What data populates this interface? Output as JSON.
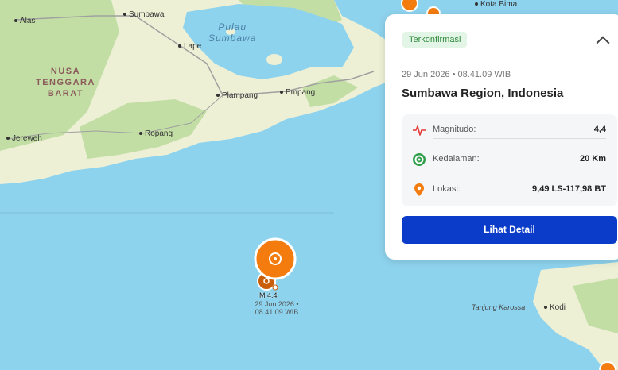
{
  "map": {
    "places": {
      "alas": "Alas",
      "sumbawa": "Sumbawa",
      "lape": "Lape",
      "plampang": "Plampang",
      "empang": "Empang",
      "jereweh": "Jereweh",
      "ropang": "Ropang",
      "kota_bima": "Kota Bima",
      "kodi": "Kodi"
    },
    "region_label": "NUSA\nTENGGARA\nBARAT",
    "island_label": "Pulau\nSumbawa",
    "cape_label": "Tanjung Karossa",
    "quake_label": "M 4.4",
    "quake_time_label": "29 Jun 2026 •\n08.41.09 WIB",
    "colors": {
      "sea": "#8ed3ee",
      "land": "#eef0d6",
      "forest": "#c3dea5",
      "quake": "#f47c0f"
    }
  },
  "card": {
    "status_badge": "Terkonfirmasi",
    "datetime": "29 Jun 2026 • 08.41.09 WIB",
    "title": "Sumbawa Region, Indonesia",
    "magnitude_label": "Magnitudo:",
    "magnitude_value": "4,4",
    "depth_label": "Kedalaman:",
    "depth_value": "20 Km",
    "location_label": "Lokasi:",
    "location_value": "9,49 LS-117,98 BT",
    "detail_button": "Lihat Detail",
    "icons": {
      "magnitude": "pulse-icon",
      "depth": "target-icon",
      "location": "map-pin-icon",
      "collapse": "chevron-up-icon"
    },
    "accent_color": "#0b3cc9"
  }
}
